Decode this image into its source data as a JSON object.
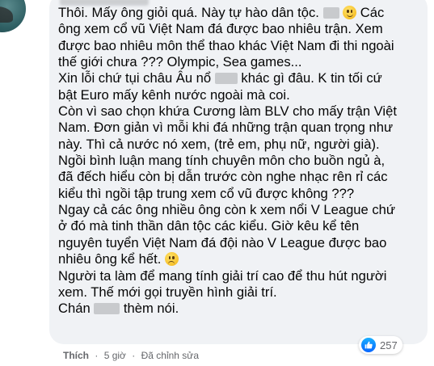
{
  "comment": {
    "lines": [
      "Thôi. Mấy ông giỏi quá. Này tự hào dân tộc.",
      "Các",
      "ông xem cổ vũ Việt Nam đá được bao nhiêu trận. Xem",
      "được bao nhiêu môn thể thao khác Việt Nam đi thi ngoài",
      "thế giới chưa ??? Olympic, Sea games...",
      "Xin lỗi chứ tụi châu Âu nổ",
      "khác gì đâu. K tin tối cứ",
      "bật Euro mấy kênh nước ngoài mà coi.",
      "Còn vì sao chọn khứa Cương làm BLV cho mấy trận Việt",
      "Nam. Đơn giản vì mỗi khi đá những trận quan trọng như",
      "này. Thì cả nước nó xem, (trẻ em, phụ nữ, người già).",
      "Ngồi bình luận mang tính chuyên môn cho buồn ngủ à,",
      "đã đếch hiểu còn bị dẫn trước còn nghe nhạc rên rỉ các",
      "kiểu thì ngồi tập trung xem cổ vũ được không ???",
      "Ngay cả các ông nhiều ông còn k xem nổi V League chứ",
      "ở đó mà tinh thần dân tộc các kiểu. Giờ kêu kể tên",
      "nguyên tuyển Việt Nam đá đội nào V League được bao",
      "nhiêu ông kể hết.",
      "Người ta làm để mang tính giải trí cao để thu hút người",
      "xem. Thế mới gọi truyền hình giải trí.",
      "Chán",
      "thèm nói."
    ],
    "emojis": {
      "smile": "slightly-smiling-face-icon",
      "sad": "slightly-frowning-face-icon"
    }
  },
  "footer": {
    "like_label": "Thích",
    "separator": "·",
    "time": "5 giờ",
    "edited": "Đã chỉnh sửa"
  },
  "reactions": {
    "icon": "like-icon",
    "count": "257"
  },
  "colors": {
    "bubble": "#f0f2f5",
    "text": "#050505",
    "meta": "#65676b",
    "like_blue": "#0866ff"
  }
}
